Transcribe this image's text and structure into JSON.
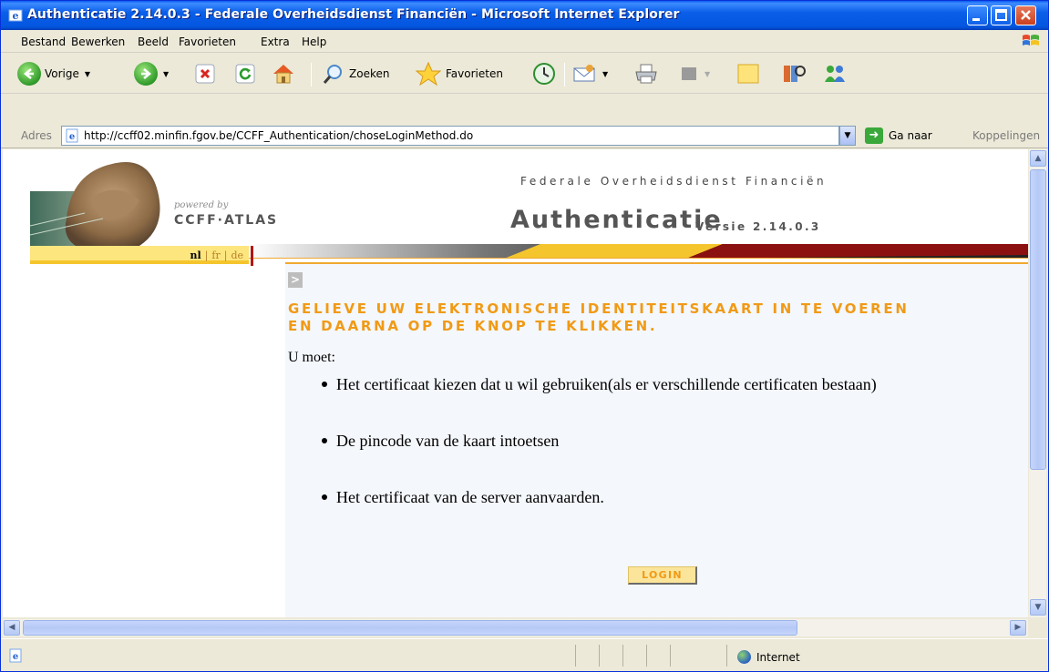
{
  "window": {
    "title": "Authenticatie 2.14.0.3 - Federale Overheidsdienst Financiën - Microsoft Internet Explorer"
  },
  "menu": {
    "items": [
      "Bestand",
      "Bewerken",
      "Beeld",
      "Favorieten",
      "Extra",
      "Help"
    ]
  },
  "toolbar": {
    "back_label": "Vorige",
    "search_label": "Zoeken",
    "favorites_label": "Favorieten"
  },
  "addressbar": {
    "label": "Adres",
    "url": "http://ccff02.minfin.fgov.be/CCFF_Authentication/choseLoginMethod.do",
    "go_label": "Ga naar",
    "links_label": "Koppelingen"
  },
  "statusbar": {
    "zone": "Internet"
  },
  "page": {
    "powered_by": "powered by",
    "brand": "CCFF·ATLAS",
    "agency": "Federale Overheidsdienst Financiën",
    "app_title": "Authenticatie",
    "app_version": "Versie 2.14.0.3",
    "languages": [
      {
        "code": "nl",
        "active": true
      },
      {
        "code": "fr",
        "active": false
      },
      {
        "code": "de",
        "active": false
      }
    ],
    "instruction_line1": "GELIEVE UW ELEKTRONISCHE IDENTITEITSKAART IN TE VOEREN",
    "instruction_line2": "EN DAARNA OP DE KNOP TE KLIKKEN.",
    "must_label": "U moet:",
    "steps": [
      "Het certificaat kiezen dat u wil gebruiken(als er verschillende certificaten bestaan)",
      "De pincode van de kaart intoetsen",
      "Het certificaat van de server aanvaarden."
    ],
    "login_label": "LOGIN"
  },
  "colors": {
    "titlebar": "#0a5ee8",
    "accent_orange": "#f09a16",
    "lang_bar": "#fde67e",
    "content_bg": "#f4f7fb",
    "band_red": "#8b1010",
    "band_yellow": "#f5c52d"
  }
}
